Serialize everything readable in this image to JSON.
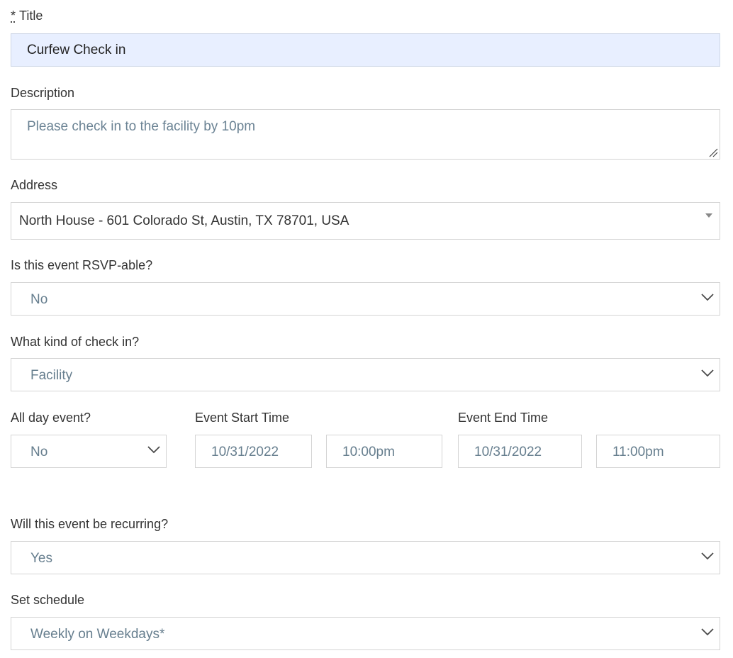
{
  "title_field": {
    "required_mark": "*",
    "label": "Title",
    "value": "Curfew Check in"
  },
  "description_field": {
    "label": "Description",
    "value": "Please check in to the facility by 10pm"
  },
  "address_field": {
    "label": "Address",
    "value": "North House - 601 Colorado St, Austin, TX 78701, USA"
  },
  "rsvp_field": {
    "label": "Is this event RSVP-able?",
    "value": "No"
  },
  "checkin_type_field": {
    "label": "What kind of check in?",
    "value": "Facility"
  },
  "all_day_field": {
    "label": "All day event?",
    "value": "No"
  },
  "start_time": {
    "label": "Event Start Time",
    "date": "10/31/2022",
    "time": "10:00pm"
  },
  "end_time": {
    "label": "Event End Time",
    "date": "10/31/2022",
    "time": "11:00pm"
  },
  "recurring_field": {
    "label": "Will this event be recurring?",
    "value": "Yes"
  },
  "schedule_field": {
    "label": "Set schedule",
    "value": "Weekly on Weekdays*"
  },
  "icons": {
    "dropdown": "chevron-down-icon",
    "address_dropdown": "caret-down-icon",
    "resize": "resize-handle-icon"
  }
}
